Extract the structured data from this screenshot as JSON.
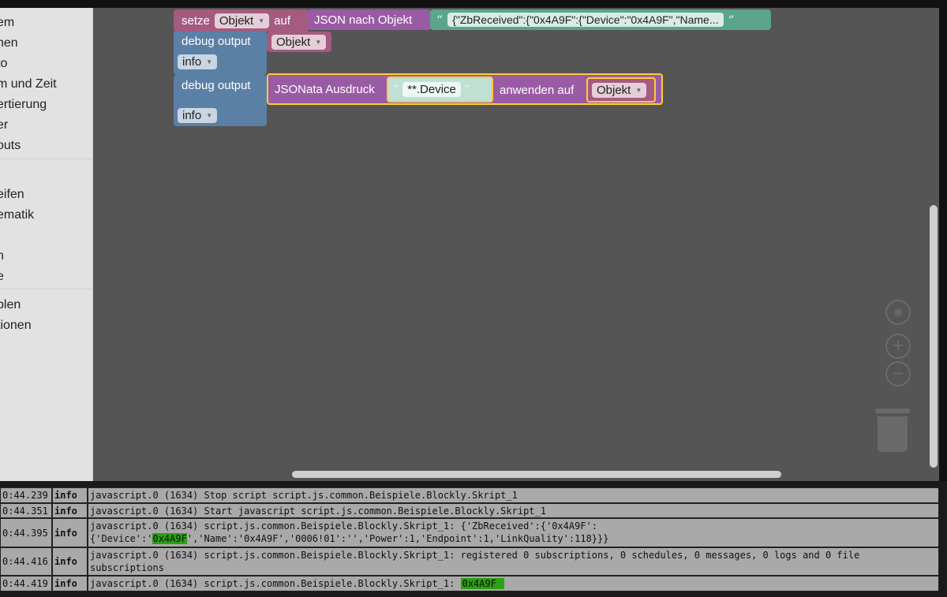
{
  "sidebar": {
    "items": [
      "em",
      "nen",
      "to",
      "m und Zeit",
      "ertierung",
      "er",
      "outs",
      "eifen",
      "ematik",
      "n",
      "e",
      "blen",
      "tionen"
    ]
  },
  "blocks": {
    "set_label": "setze",
    "set_var": "Objekt",
    "set_to": "auf",
    "json_to_obj": "JSON nach Objekt",
    "json_text": "{\"ZbReceived\":{\"0x4A9F\":{\"Device\":\"0x4A9F\",\"Name...",
    "debug1_label": "debug output",
    "debug1_var": "Objekt",
    "debug1_level": "info",
    "debug2_label": "debug output",
    "jsonata_label": "JSONata Ausdruck",
    "jsonata_expr": "**.Device",
    "apply_label": "anwenden auf",
    "apply_var": "Objekt",
    "debug2_level": "info",
    "quote_open": "“",
    "quote_close": "”"
  },
  "log": [
    {
      "time": "0:44.239",
      "level": "info",
      "msg": "javascript.0 (1634) Stop script script.js.common.Beispiele.Blockly.Skript_1"
    },
    {
      "time": "0:44.351",
      "level": "info",
      "msg": "javascript.0 (1634) Start javascript script.js.common.Beispiele.Blockly.Skript_1"
    },
    {
      "time": "0:44.395",
      "level": "info",
      "msg_a": "javascript.0 (1634) script.js.common.Beispiele.Blockly.Skript_1: {'ZbReceived':{'0x4A9F':",
      "msg_b1": "{'Device':'",
      "msg_hl": "0x4A9F",
      "msg_b2": "','Name':'0x4A9F','0006!01':'','Power':1,'Endpoint':1,'LinkQuality':118}}}"
    },
    {
      "time": "0:44.416",
      "level": "info",
      "msg": "javascript.0 (1634) script.js.common.Beispiele.Blockly.Skript_1: registered 0 subscriptions, 0 schedules, 0 messages, 0 logs and 0 file subscriptions"
    },
    {
      "time": "0:44.419",
      "level": "info",
      "msg": "javascript.0 (1634) script.js.common.Beispiele.Blockly.Skript_1: ",
      "msg_hl": "0x4A9F"
    }
  ]
}
